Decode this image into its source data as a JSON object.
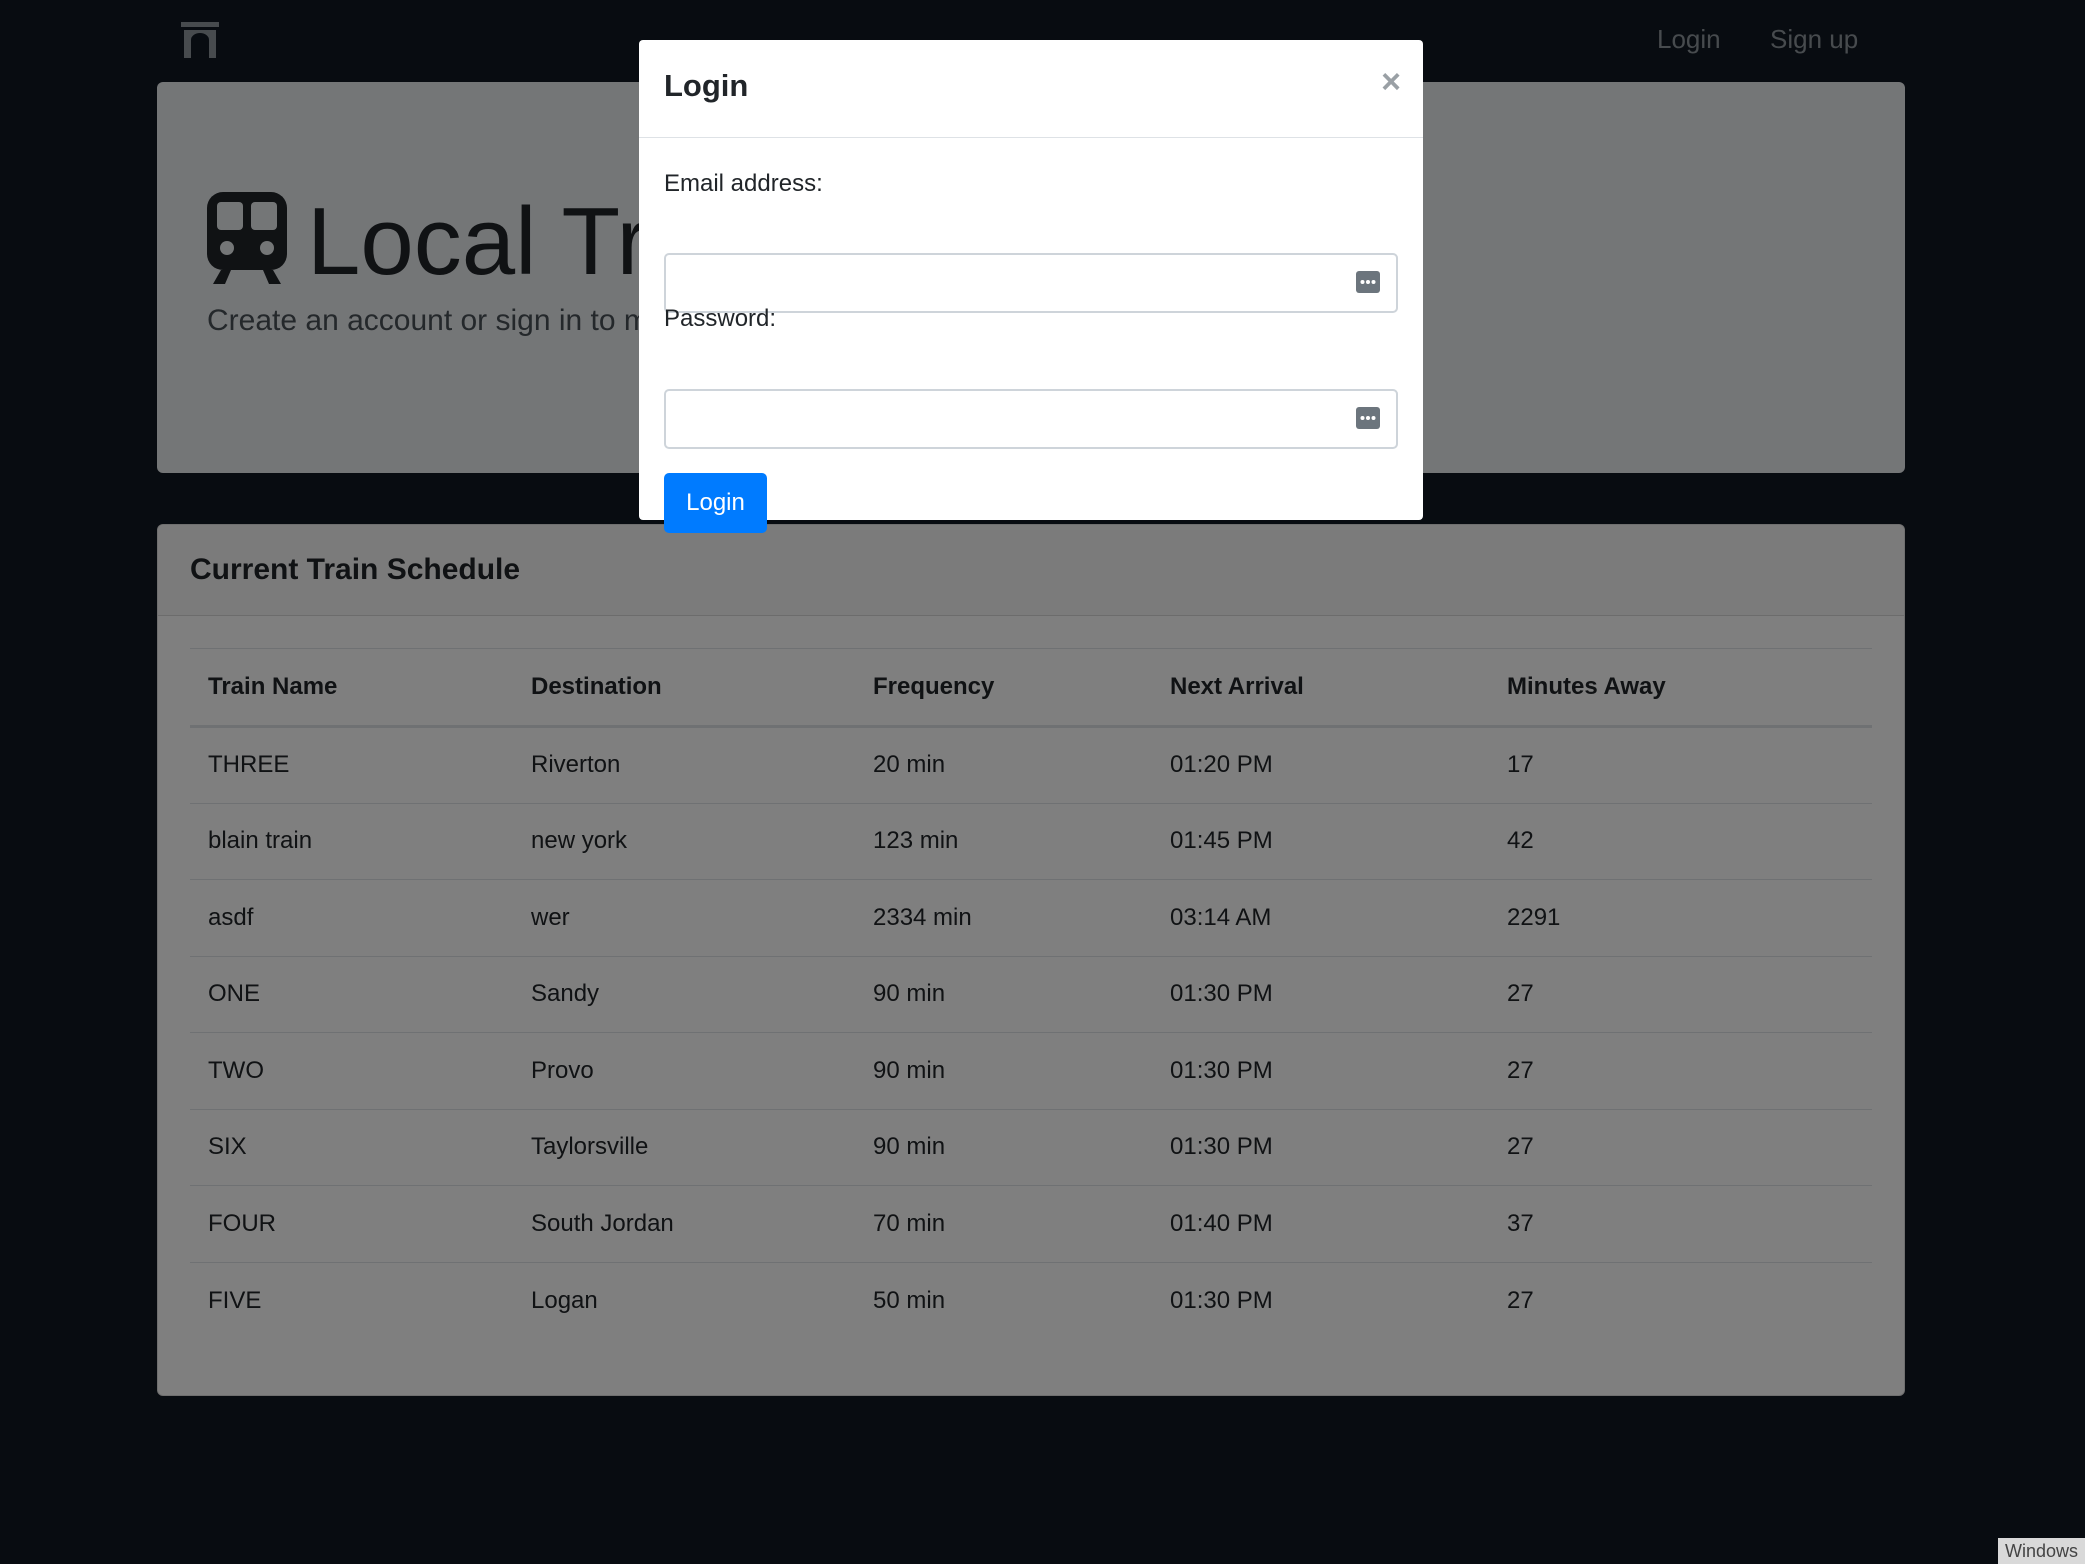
{
  "navbar": {
    "logo": "archway-icon",
    "links": [
      "Login",
      "Sign up"
    ]
  },
  "jumbotron": {
    "icon": "train-icon",
    "title": "Local Train",
    "lead": "Create an account or sign in to m"
  },
  "schedule": {
    "header": "Current Train Schedule",
    "columns": [
      "Train Name",
      "Destination",
      "Frequency",
      "Next Arrival",
      "Minutes Away"
    ],
    "rows": [
      [
        "THREE",
        "Riverton",
        "20 min",
        "01:20 PM",
        "17"
      ],
      [
        "blain train",
        "new york",
        "123 min",
        "01:45 PM",
        "42"
      ],
      [
        "asdf",
        "wer",
        "2334 min",
        "03:14 AM",
        "2291"
      ],
      [
        "ONE",
        "Sandy",
        "90 min",
        "01:30 PM",
        "27"
      ],
      [
        "TWO",
        "Provo",
        "90 min",
        "01:30 PM",
        "27"
      ],
      [
        "SIX",
        "Taylorsville",
        "90 min",
        "01:30 PM",
        "27"
      ],
      [
        "FOUR",
        "South Jordan",
        "70 min",
        "01:40 PM",
        "37"
      ],
      [
        "FIVE",
        "Logan",
        "50 min",
        "01:30 PM",
        "27"
      ]
    ]
  },
  "modal": {
    "title": "Login",
    "close": "×",
    "email_label": "Email address:",
    "email_value": "",
    "password_label": "Password:",
    "password_value": "",
    "submit_label": "Login"
  },
  "watermark": "Windows",
  "colors": {
    "page_bg": "#111923",
    "primary": "#007bff",
    "jumbotron_bg": "#e9ecef",
    "card_header_bg": "#f7f7f7"
  }
}
